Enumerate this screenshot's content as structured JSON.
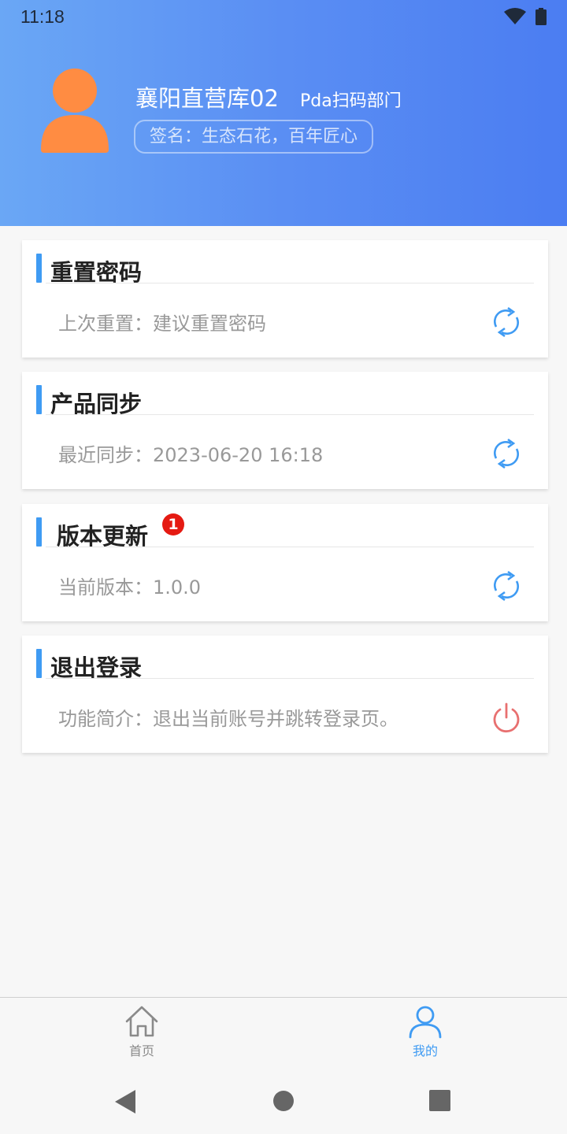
{
  "status_bar": {
    "time": "11:18"
  },
  "profile": {
    "name": "襄阳直营库02",
    "department": "Pda扫码部门",
    "signature": "签名：生态石花，百年匠心"
  },
  "cards": [
    {
      "title": "重置密码",
      "text": "上次重置：建议重置密码",
      "action_icon": "refresh-icon"
    },
    {
      "title": "产品同步",
      "text": "最近同步：2023-06-20 16:18",
      "action_icon": "refresh-icon"
    },
    {
      "title": "版本更新",
      "badge": "1",
      "text": "当前版本：1.0.0",
      "action_icon": "refresh-icon"
    },
    {
      "title": "退出登录",
      "text": "功能简介：退出当前账号并跳转登录页。",
      "action_icon": "power-icon"
    }
  ],
  "tabs": [
    {
      "label": "首页",
      "icon": "home-icon",
      "active": false
    },
    {
      "label": "我的",
      "icon": "user-icon",
      "active": true
    }
  ],
  "colors": {
    "accent": "#3f9bf3",
    "header_start": "#6aa7f5",
    "header_end": "#4b7df2",
    "avatar": "#ff8c42",
    "badge": "#e51a12",
    "logout": "#e87070"
  }
}
